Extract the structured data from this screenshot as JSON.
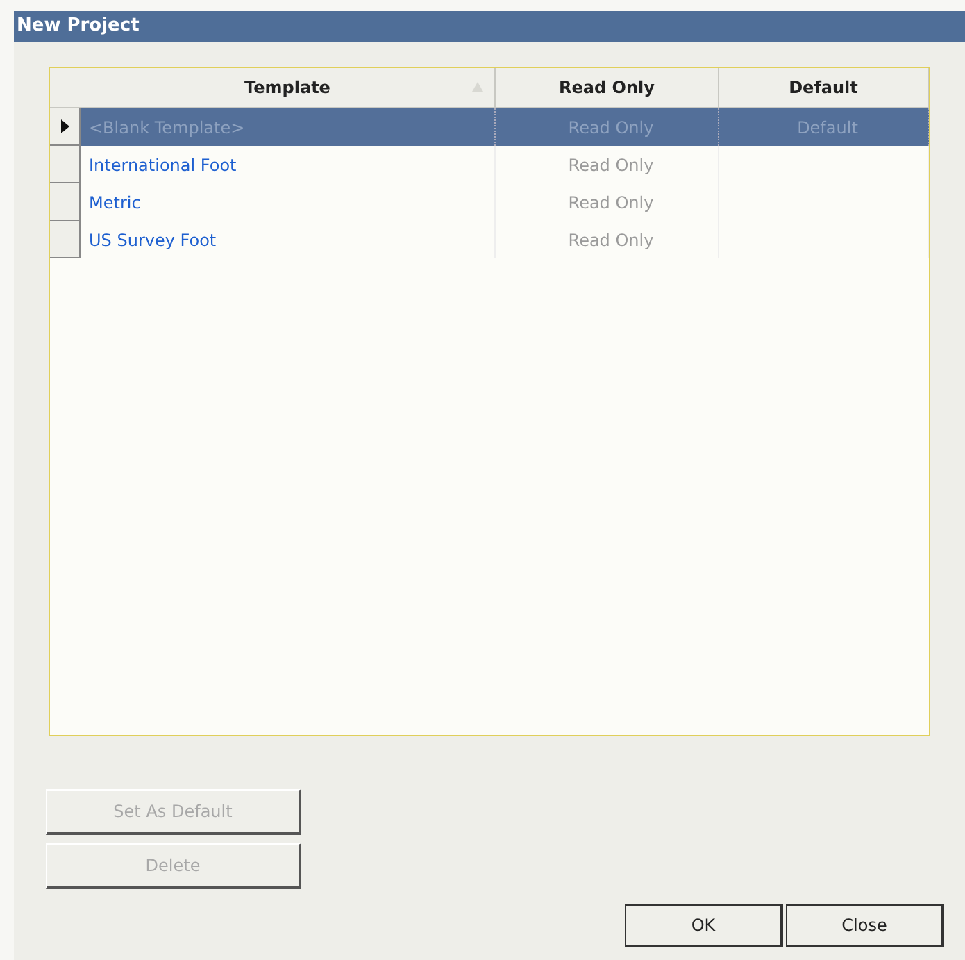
{
  "window": {
    "title": "New Project"
  },
  "table": {
    "columns": [
      {
        "label": "Template",
        "sorted": true
      },
      {
        "label": "Read Only",
        "sorted": false
      },
      {
        "label": "Default",
        "sorted": false
      }
    ],
    "rows": [
      {
        "template": "<Blank Template>",
        "read_only": "Read Only",
        "default": "Default",
        "selected": true
      },
      {
        "template": "International Foot",
        "read_only": "Read Only",
        "selected": false
      },
      {
        "template": "Metric",
        "read_only": "Read Only",
        "selected": false
      },
      {
        "template": "US Survey Foot",
        "read_only": "Read Only",
        "selected": false
      }
    ]
  },
  "side_buttons": [
    {
      "label": "Set As Default",
      "disabled": true
    },
    {
      "label": "Delete",
      "disabled": true
    }
  ],
  "buttons": [
    {
      "label": "OK",
      "disabled": false
    },
    {
      "label": "Close",
      "disabled": false
    }
  ]
}
